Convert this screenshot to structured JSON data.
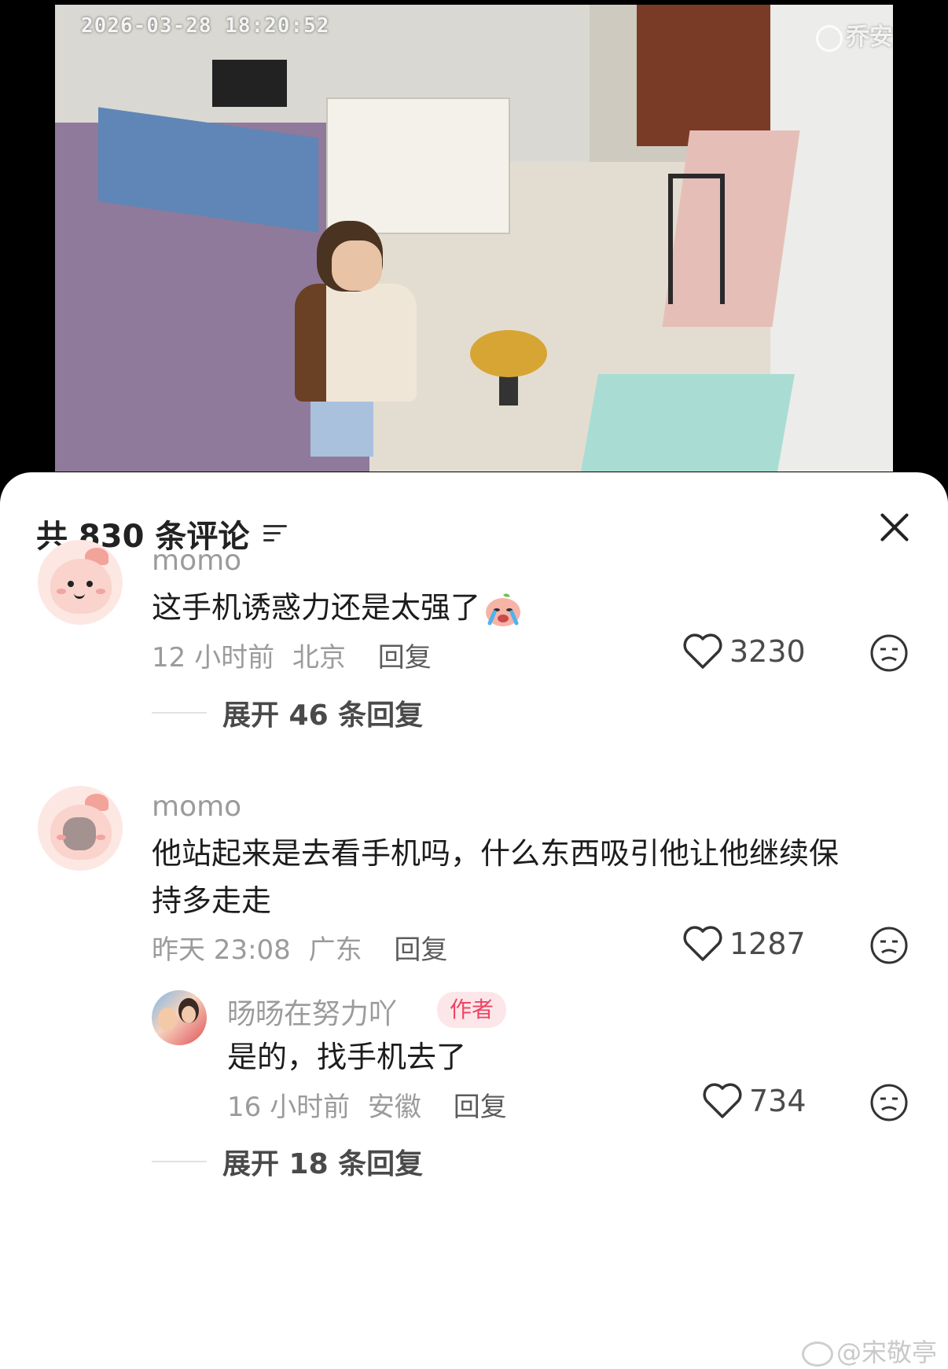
{
  "video": {
    "timestamp": "2026-03-28  18:20:52",
    "brand_watermark": "乔安"
  },
  "comments_panel": {
    "title": "共 830 条评论",
    "filter_icon": "filter-icon",
    "close_icon": "close-icon"
  },
  "comments": [
    {
      "username": "momo",
      "text": "这手机诱惑力还是太强了",
      "emoji": "crying-emoji",
      "time": "12 小时前",
      "location": "北京",
      "reply_label": "回复",
      "likes": "3230",
      "expand_label": "展开 46 条回复"
    },
    {
      "username": "momo",
      "text_line1": "他站起来是去看手机吗，什么东西吸引他让他继续保",
      "text_line2": "持多走走",
      "time": "昨天 23:08",
      "location": "广东",
      "reply_label": "回复",
      "likes": "1287",
      "reply": {
        "username": "旸旸在努力吖",
        "badge": "作者",
        "text": "是的，找手机去了",
        "time": "16 小时前",
        "location": "安徽",
        "reply_label": "回复",
        "likes": "734"
      },
      "expand_label": "展开 18 条回复"
    }
  ],
  "watermark": "@宋敬亭",
  "colors": {
    "author_badge_text": "#ee4563",
    "author_badge_bg": "#fde6ea",
    "meta_gray": "#9b9b9b"
  }
}
